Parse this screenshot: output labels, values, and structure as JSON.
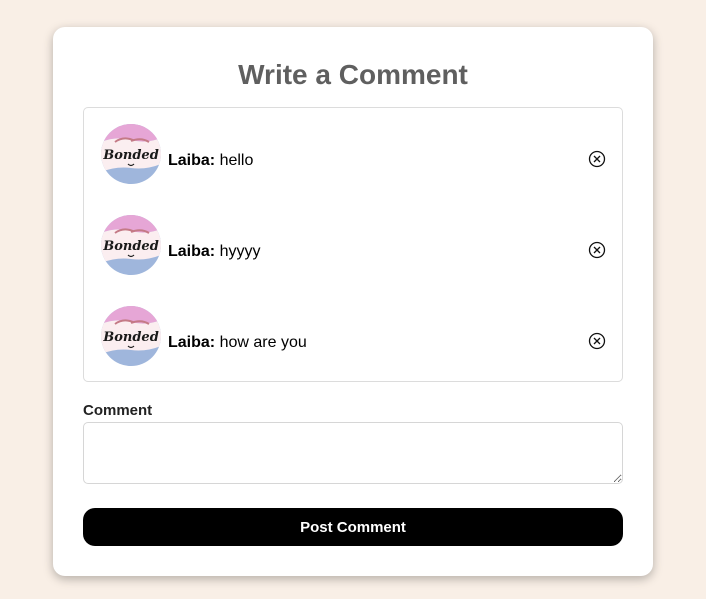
{
  "form": {
    "title": "Write a Comment",
    "comment_label": "Comment",
    "comment_value": "",
    "comment_placeholder": "",
    "post_button_label": "Post Comment"
  },
  "avatar": {
    "brand_text": "Bonded"
  },
  "comments": [
    {
      "author": "Laiba:",
      "text": "hello"
    },
    {
      "author": "Laiba:",
      "text": "hyyyy"
    },
    {
      "author": "Laiba:",
      "text": "how are you"
    }
  ],
  "icons": {
    "delete": "close-circle-icon"
  },
  "colors": {
    "background": "#f9efe6",
    "card": "#ffffff",
    "title": "#5f5f5f",
    "button": "#000000",
    "button_text": "#ffffff",
    "avatar_top": "#e6a6d6",
    "avatar_bottom": "#9fb6dc"
  }
}
